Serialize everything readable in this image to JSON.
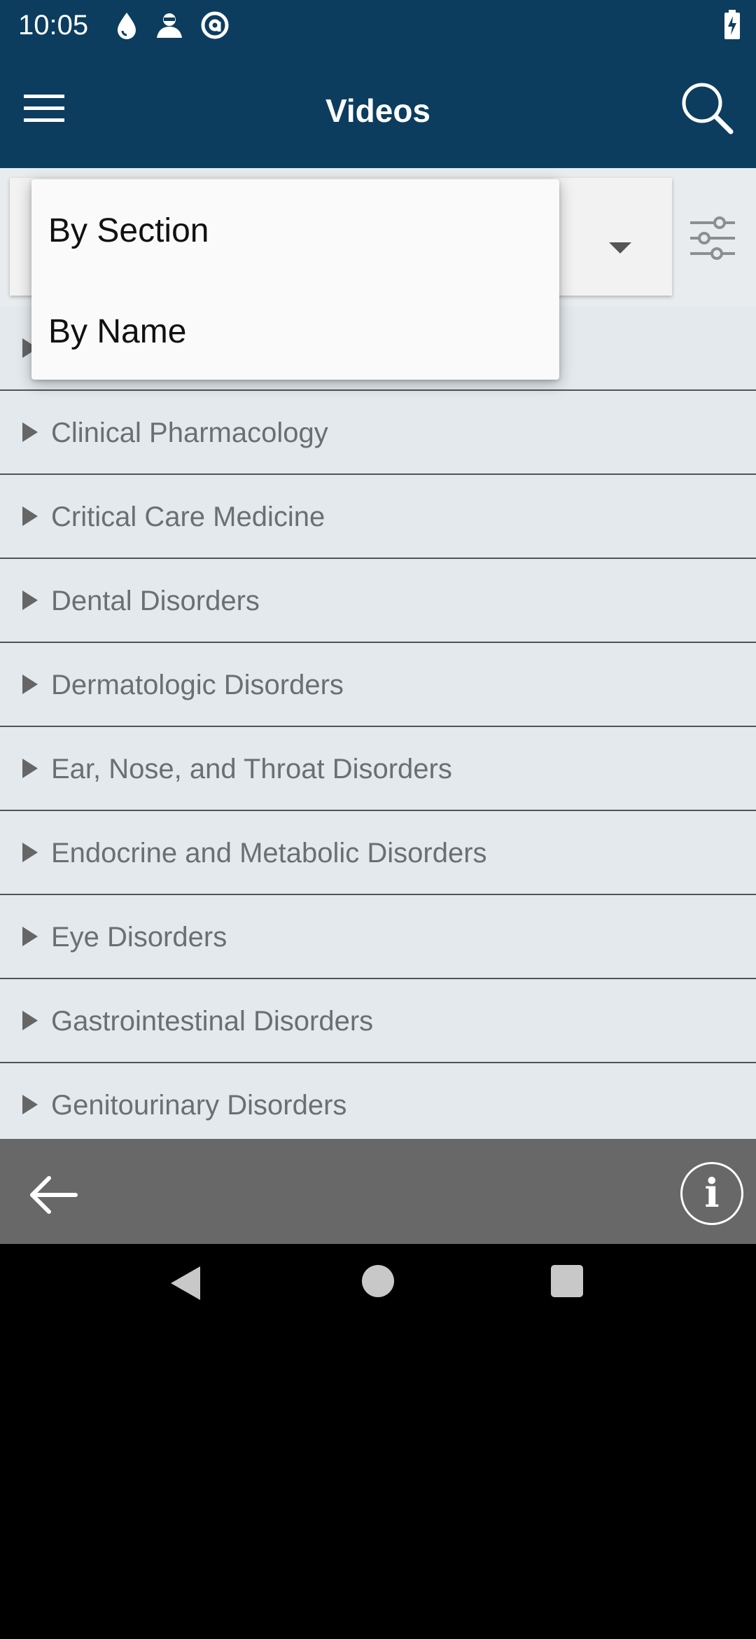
{
  "status_bar": {
    "time": "10:05",
    "icons": [
      "water-drop-icon",
      "incognito-icon",
      "at-sign-icon"
    ],
    "battery_icon": "battery-charging-icon"
  },
  "app_bar": {
    "title": "Videos",
    "menu_icon": "hamburger-menu-icon",
    "search_icon": "search-icon",
    "background": "#0c3d5e"
  },
  "filter": {
    "filter_icon": "sliders-icon"
  },
  "dropdown": {
    "options": [
      "By Section",
      "By Name"
    ]
  },
  "list": {
    "items": [
      "",
      "Clinical Pharmacology",
      "Critical Care Medicine",
      "Dental Disorders",
      "Dermatologic Disorders",
      "Ear, Nose, and Throat Disorders",
      "Endocrine and Metabolic Disorders",
      "Eye Disorders",
      "Gastrointestinal Disorders",
      "Genitourinary Disorders"
    ]
  },
  "bottom_bar": {
    "back_icon": "arrow-left-icon",
    "info_label": "i",
    "background": "#686868"
  },
  "nav_bar": {
    "buttons": [
      "nav-back-icon",
      "nav-home-icon",
      "nav-recents-icon"
    ]
  }
}
